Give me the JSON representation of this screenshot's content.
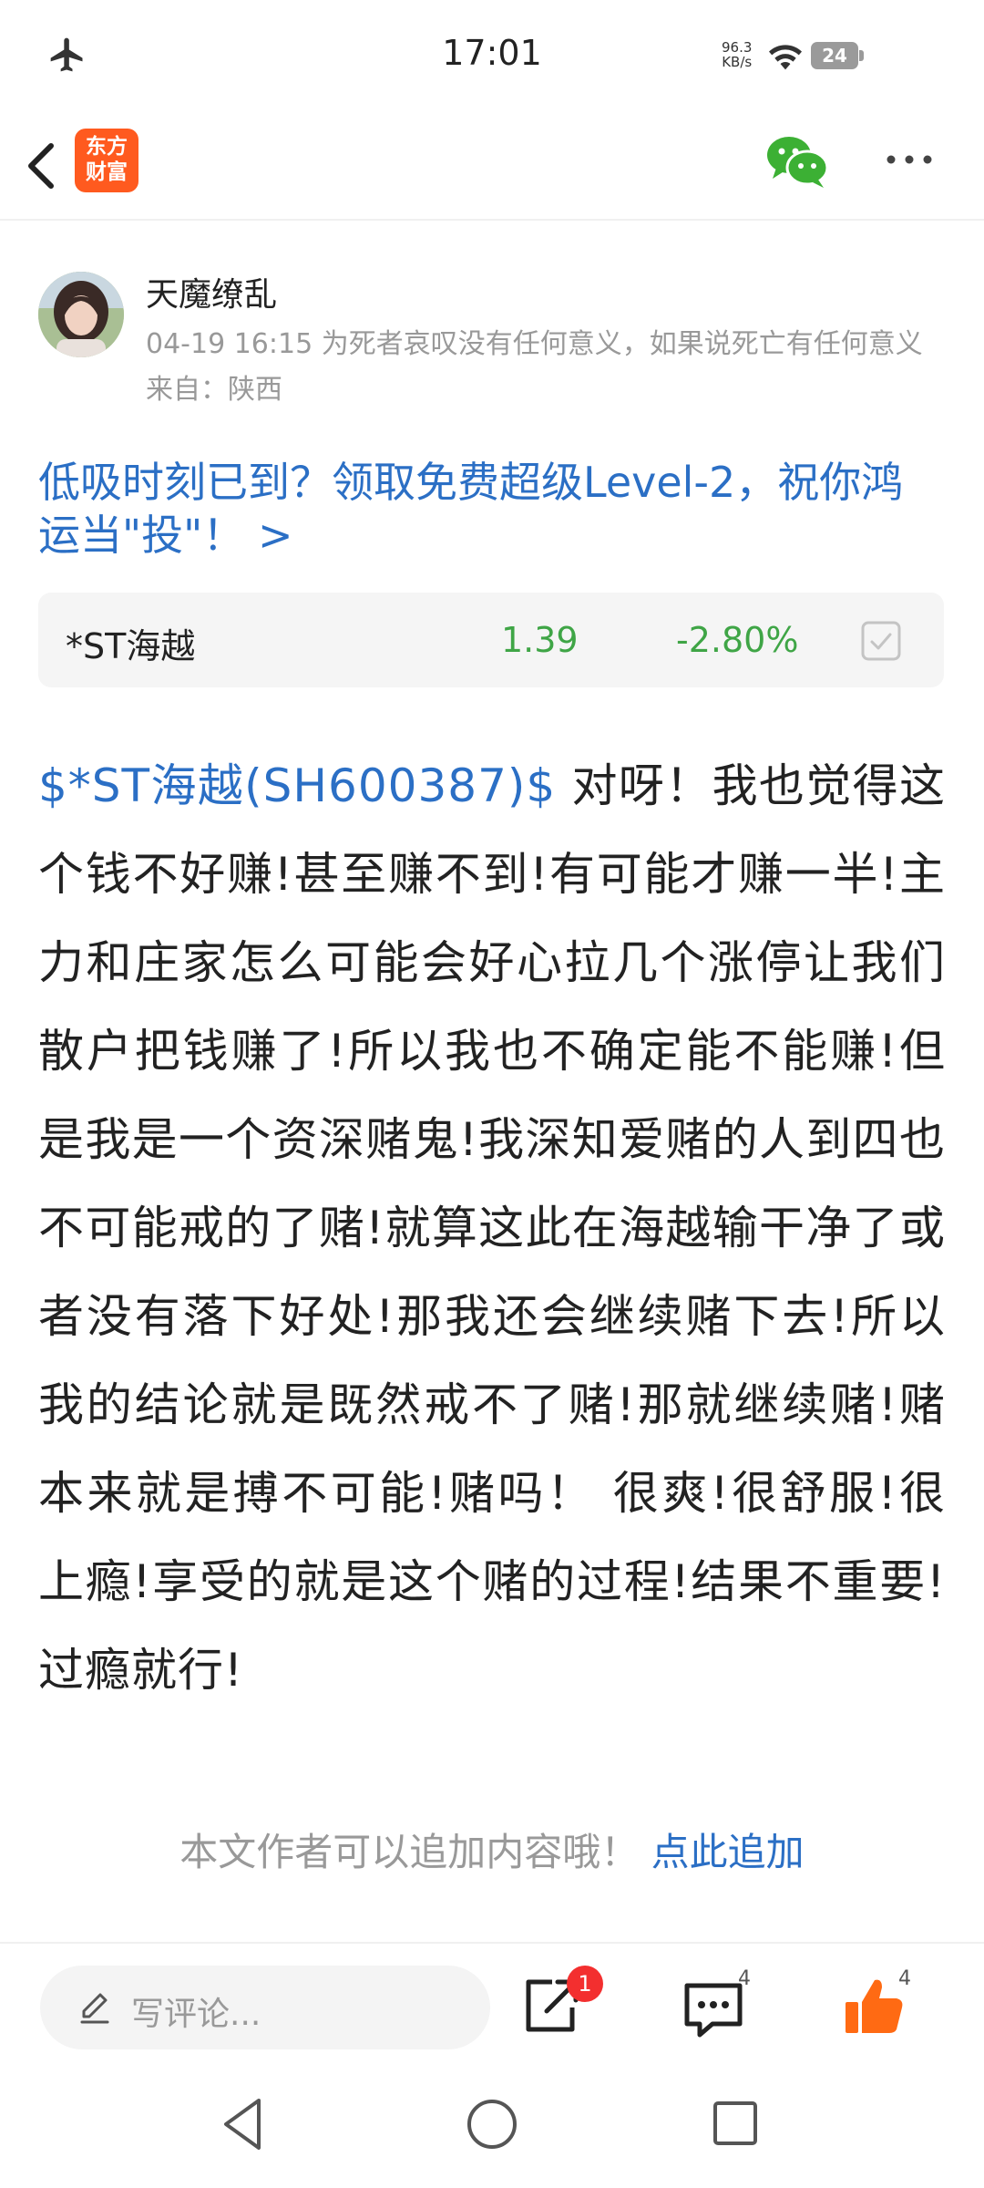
{
  "status_bar": {
    "time": "17:01",
    "speed_value": "96.3",
    "speed_unit": "KB/s",
    "battery_level": "24",
    "icons": [
      "airplane-icon",
      "wifi-icon",
      "battery-icon"
    ]
  },
  "nav": {
    "logo_line1": "东方",
    "logo_line2": "财富",
    "icons": [
      "back-arrow-icon",
      "wechat-icon",
      "more-icon"
    ],
    "accent_color": "#ff5a1f"
  },
  "author": {
    "name": "天魔缭乱",
    "meta": "04-19 16:15 为死者哀叹没有任何意义，如果说死亡有任何意义",
    "location": "来自：陕西"
  },
  "promo": {
    "text": "低吸时刻已到？领取免费超级Level-2，祝你鸿运当\"投\"！ >"
  },
  "stock_card": {
    "name": "*ST海越",
    "price": "1.39",
    "change": "-2.80%",
    "down_color": "#3fa546"
  },
  "post": {
    "stock_tag": "$*ST海越(SH600387)$",
    "body": "  对呀！我也觉得这个钱不好赚!甚至赚不到!有可能才赚一半!主力和庄家怎么可能会好心拉几个涨停让我们散户把钱赚了!所以我也不确定能不能赚!但是我是一个资深赌鬼!我深知爱赌的人到四也不可能戒的了赌!就算这此在海越输干净了或者没有落下好处!那我还会继续赌下去!所以我的结论就是既然戒不了赌!那就继续赌!赌本来就是搏不可能!赌吗！ 很爽!很舒服!很上瘾!享受的就是这个赌的过程!结果不重要!过瘾就行!",
    "link_color": "#2b6fc5"
  },
  "append": {
    "notice": "本文作者可以追加内容哦！",
    "link": "点此追加"
  },
  "bottom_bar": {
    "comment_placeholder": "写评论...",
    "share_badge": "1",
    "comment_count": "4",
    "like_count": "4",
    "like_color": "#ff6a13"
  },
  "system_nav": {
    "icons": [
      "nav-back-icon",
      "nav-home-icon",
      "nav-recent-icon"
    ]
  }
}
